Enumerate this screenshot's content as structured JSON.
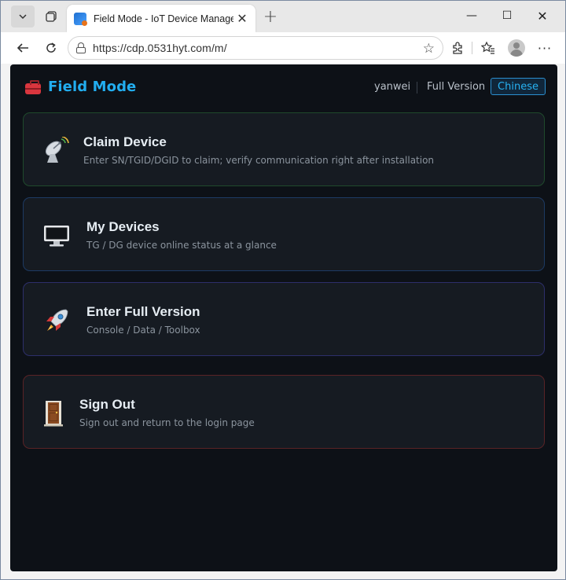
{
  "browser": {
    "tab_title": "Field Mode - IoT Device Managem",
    "url": "https://cdp.0531hyt.com/m/",
    "tab_close": "✕",
    "new_tab": "+",
    "window_controls": {
      "minimize": "—",
      "maximize": "☐",
      "close": "✕"
    },
    "icons": [
      "tab-actions-icon",
      "workspaces-icon",
      "back-icon",
      "refresh-icon",
      "lock-icon",
      "star-icon",
      "extensions-icon",
      "favorites-icon",
      "profile-icon",
      "more-icon"
    ]
  },
  "header": {
    "brand": "Field Mode",
    "user": "yanwei",
    "full_version_link": "Full Version",
    "language_button": "Chinese",
    "brand_icon": "toolbox-icon"
  },
  "cards": [
    {
      "title": "Claim Device",
      "description": "Enter SN/TGID/DGID to claim; verify communication right after installation",
      "icon": "satellite-dish-icon",
      "border_color": "#1f4a2c"
    },
    {
      "title": "My Devices",
      "description": "TG / DG device online status at a glance",
      "icon": "monitor-icon",
      "border_color": "#1d3a63"
    },
    {
      "title": "Enter Full Version",
      "description": "Console / Data / Toolbox",
      "icon": "rocket-icon",
      "border_color": "#2d2f6b"
    },
    {
      "title": "Sign Out",
      "description": "Sign out and return to the login page",
      "icon": "door-icon",
      "border_color": "#5a2326"
    }
  ],
  "colors": {
    "page_background": "#0d1117",
    "card_background": "#161b22",
    "brand_accent": "#22aef0",
    "title_text": "#e6edf3",
    "description_text": "#8b949e"
  }
}
